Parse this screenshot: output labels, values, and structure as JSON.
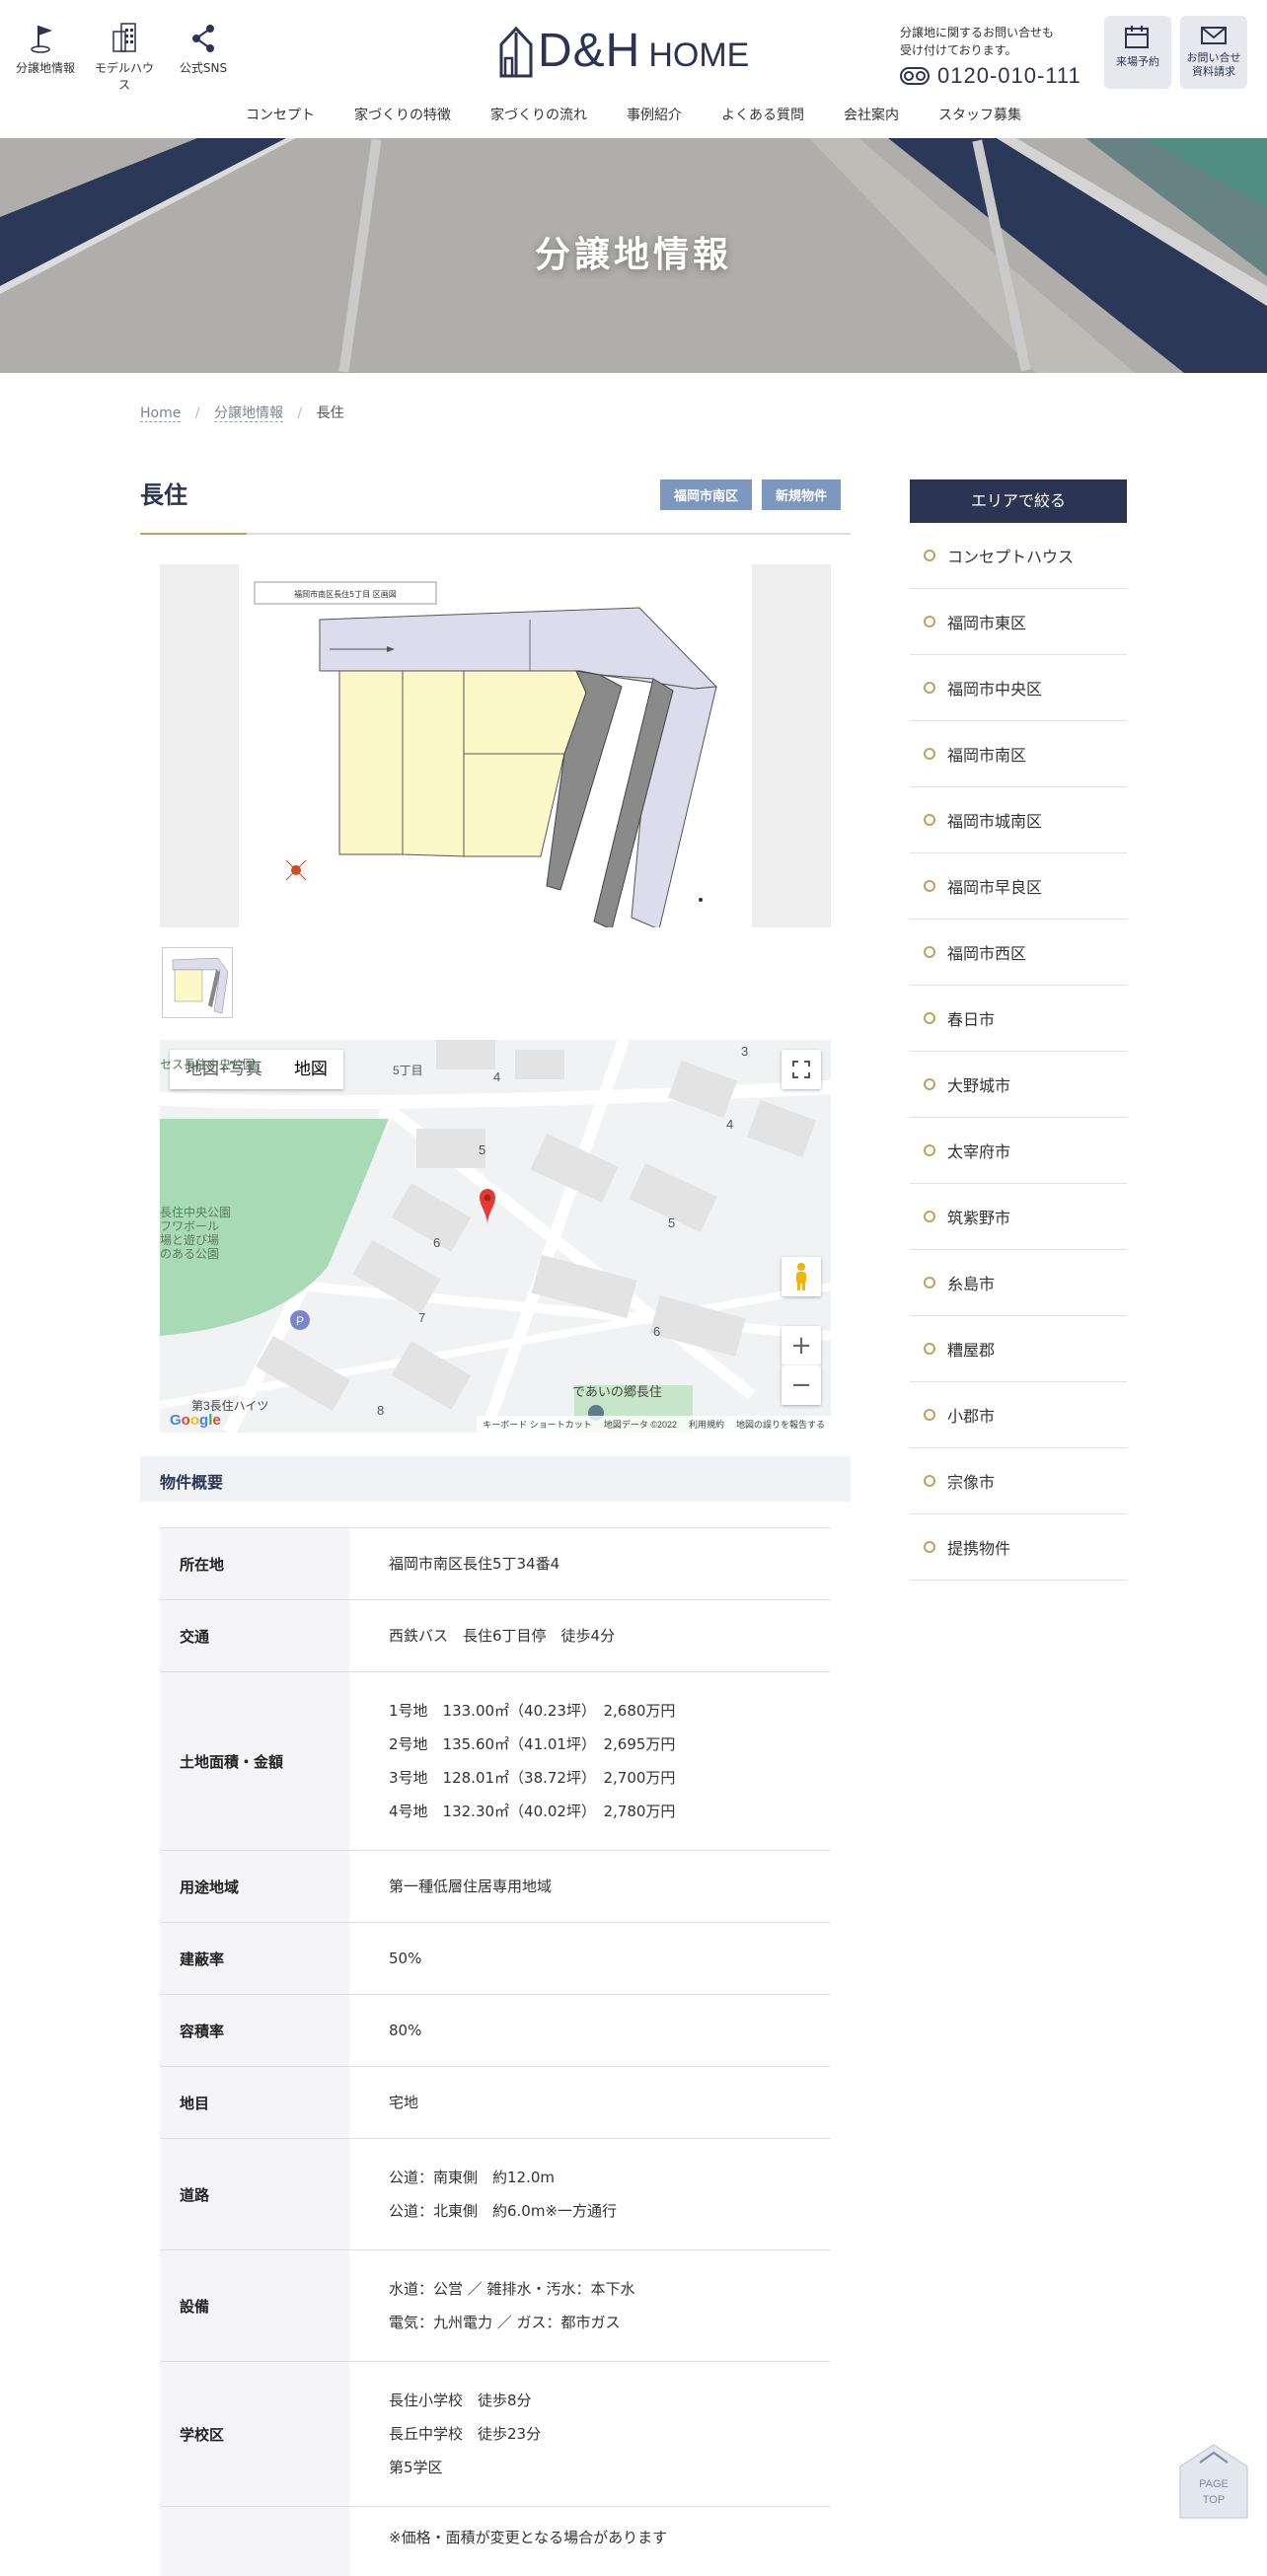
{
  "header": {
    "icons": [
      {
        "label": "分譲地情報",
        "icon": "flag-icon"
      },
      {
        "label": "モデルハウス",
        "icon": "building-icon"
      },
      {
        "label": "公式SNS",
        "icon": "share-icon"
      }
    ],
    "logo_main": "D&H",
    "logo_sub": "HOME",
    "contact_note_1": "分譲地に関するお問い合せも",
    "contact_note_2": "受け付けております。",
    "tel": "0120-010-111",
    "reserve_label": "来場予約",
    "request_label_1": "お問い合せ",
    "request_label_2": "資料請求",
    "nav": [
      "コンセプト",
      "家づくりの特徴",
      "家づくりの流れ",
      "事例紹介",
      "よくある質問",
      "会社案内",
      "スタッフ募集"
    ]
  },
  "hero": {
    "title": "分譲地情報"
  },
  "breadcrumb": {
    "home": "Home",
    "parent": "分譲地情報",
    "current": "長住"
  },
  "property": {
    "title": "長住",
    "tags": [
      "福岡市南区",
      "新規物件"
    ],
    "plan_caption": "福岡市南区長住5丁目 区画図"
  },
  "map": {
    "tab_map_photo": "地図+写真",
    "tab_map": "地図",
    "labels": {
      "park": "セス長住中央公園",
      "park2_1": "長住中央公園",
      "park2_2": "フワボール",
      "park2_3": "場と遊び場",
      "park2_4": "のある公園",
      "heights": "第3長住ハイツ",
      "deaino": "であいの郷長住",
      "chome": "5丁目"
    },
    "numbers": [
      "4",
      "3",
      "4",
      "5",
      "5",
      "6",
      "6",
      "7",
      "8"
    ],
    "footer": [
      "キーボード ショートカット",
      "地図データ ©2022",
      "利用規約",
      "地図の誤りを報告する"
    ],
    "google": "Google"
  },
  "spec": {
    "section_title": "物件概要",
    "rows": [
      {
        "label": "所在地",
        "lines": [
          "福岡市南区長住5丁34番4"
        ]
      },
      {
        "label": "交通",
        "lines": [
          "西鉄バス　長住6丁目停　徒歩4分"
        ]
      },
      {
        "label": "土地面積・金額",
        "lines": [
          "1号地　133.00㎡（40.23坪）　2,680万円",
          "2号地　135.60㎡（41.01坪）　2,695万円",
          "3号地　128.01㎡（38.72坪）　2,700万円",
          "4号地　132.30㎡（40.02坪）　2,780万円"
        ]
      },
      {
        "label": "用途地域",
        "lines": [
          "第一種低層住居専用地域"
        ]
      },
      {
        "label": "建蔽率",
        "lines": [
          "50%"
        ]
      },
      {
        "label": "容積率",
        "lines": [
          "80%"
        ]
      },
      {
        "label": "地目",
        "lines": [
          "宅地"
        ]
      },
      {
        "label": "道路",
        "lines": [
          "公道：南東側　約12.0m",
          "公道：北東側　約6.0m※一方通行"
        ]
      },
      {
        "label": "設備",
        "lines": [
          "水道：公営 ／ 雑排水・汚水：本下水",
          "電気：九州電力 ／ ガス：都市ガス"
        ]
      },
      {
        "label": "学校区",
        "lines": [
          "長住小学校　徒歩8分",
          "長丘中学校　徒歩23分",
          "第5学区"
        ]
      },
      {
        "label": "",
        "lines": [
          "※価格・面積が変更となる場合があります"
        ]
      }
    ]
  },
  "sidebar": {
    "title": "エリアで絞る",
    "items": [
      "コンセプトハウス",
      "福岡市東区",
      "福岡市中央区",
      "福岡市南区",
      "福岡市城南区",
      "福岡市早良区",
      "福岡市西区",
      "春日市",
      "大野城市",
      "太宰府市",
      "筑紫野市",
      "糸島市",
      "糟屋郡",
      "小郡市",
      "宗像市",
      "提携物件"
    ]
  },
  "pagetop": {
    "line1": "PAGE",
    "line2": "TOP"
  },
  "colors": {
    "navy": "#2b3452",
    "gold": "#c2a05a",
    "tag": "#7e97bf"
  }
}
